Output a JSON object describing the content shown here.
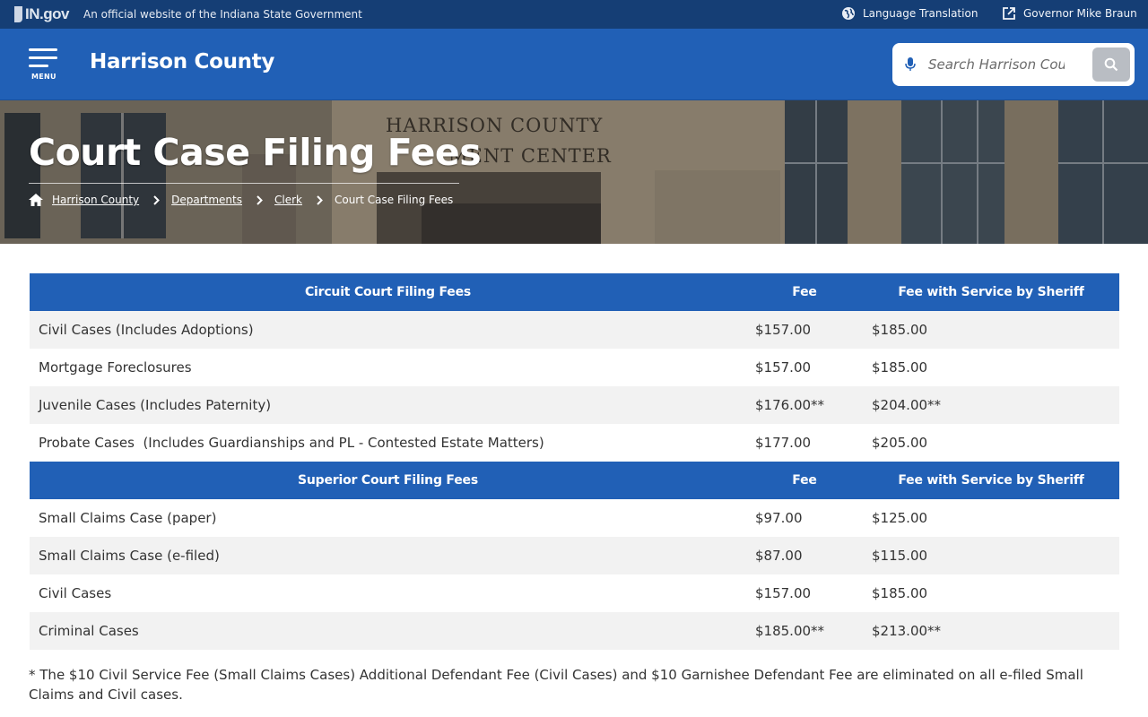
{
  "statebar": {
    "logo_text": "IN.gov",
    "official_text": "An official website of the Indiana State Government",
    "language_label": "Language Translation",
    "governor_label": "Governor Mike Braun"
  },
  "header": {
    "menu_label": "MENU",
    "site_title": "Harrison County",
    "search_placeholder": "Search Harrison County"
  },
  "hero": {
    "sign_line1": "HARRISON COUNTY",
    "sign_line2": "MENT CENTER",
    "page_title": "Court Case Filing Fees",
    "breadcrumbs": [
      "Harrison County",
      "Departments",
      "Clerk",
      "Court Case Filing Fees"
    ]
  },
  "table": {
    "sections": [
      {
        "headers": [
          "Circuit Court Filing Fees",
          "Fee",
          "Fee with Service by Sheriff"
        ],
        "rows": [
          [
            "Civil Cases (Includes Adoptions)",
            "$157.00",
            "$185.00"
          ],
          [
            "Mortgage Foreclosures",
            "$157.00",
            "$185.00"
          ],
          [
            "Juvenile Cases (Includes Paternity)",
            "$176.00**",
            "$204.00**"
          ],
          [
            "Probate Cases  (Includes Guardianships and PL - Contested Estate Matters)",
            "$177.00",
            "$205.00"
          ]
        ]
      },
      {
        "headers": [
          "Superior Court Filing Fees",
          "Fee",
          "Fee with Service by Sheriff"
        ],
        "rows": [
          [
            "Small Claims Case (paper)",
            "$97.00",
            "$125.00"
          ],
          [
            "Small Claims Case (e-filed)",
            "$87.00",
            "$115.00"
          ],
          [
            "Civil Cases",
            "$157.00",
            "$185.00"
          ],
          [
            "Criminal Cases",
            "$185.00**",
            "$213.00**"
          ]
        ]
      }
    ]
  },
  "footnote": "* The $10 Civil Service Fee (Small Claims Cases) Additional Defendant Fee (Civil Cases) and $10 Garnishee Defendant Fee are eliminated on all e-filed Small Claims and Civil cases.",
  "colors": {
    "brand_blue": "#2160b6",
    "state_bar": "#153e75",
    "row_alt": "#f2f2f2"
  }
}
